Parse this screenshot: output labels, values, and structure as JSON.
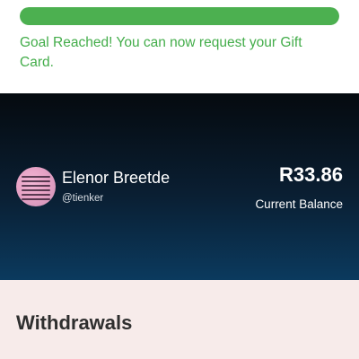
{
  "progress": {
    "fraction": 1.0,
    "fill_color": "#4cb050",
    "message": "Goal Reached! You can now request your Gift Card.",
    "message_color": "#43ad4a"
  },
  "profile": {
    "name": "Elenor Breetde",
    "handle": "@tienker",
    "balance_amount": "R33.86",
    "balance_label": "Current Balance",
    "avatar_icon": "profile-avatar-image"
  },
  "withdrawals": {
    "title": "Withdrawals",
    "background_color": "#f7ebea"
  }
}
